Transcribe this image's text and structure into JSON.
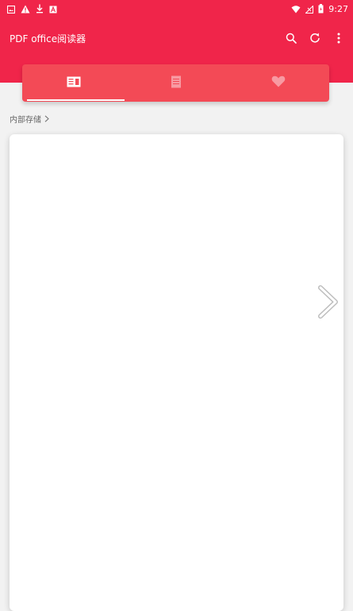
{
  "status_bar": {
    "time": "9:27",
    "left_icons": [
      "gallery-icon",
      "warning-icon",
      "download-icon",
      "a-icon"
    ],
    "right_icons": [
      "wifi-icon",
      "no-signal-icon",
      "battery-icon"
    ]
  },
  "app": {
    "title": "PDF office阅读器"
  },
  "toolbar": {
    "actions": [
      "search-icon",
      "refresh-icon",
      "more-vert-icon"
    ]
  },
  "tabs": [
    {
      "icon": "book-icon",
      "active": true
    },
    {
      "icon": "document-icon",
      "active": false
    },
    {
      "icon": "heart-icon",
      "active": false
    }
  ],
  "breadcrumb": {
    "label": "内部存储",
    "chevron": "chevron-right-icon"
  },
  "colors": {
    "primary": "#f0254a",
    "tab_bar": "#f34a56",
    "background": "#f2f2f2"
  },
  "content_panel_icon": "chevron-right-icon"
}
